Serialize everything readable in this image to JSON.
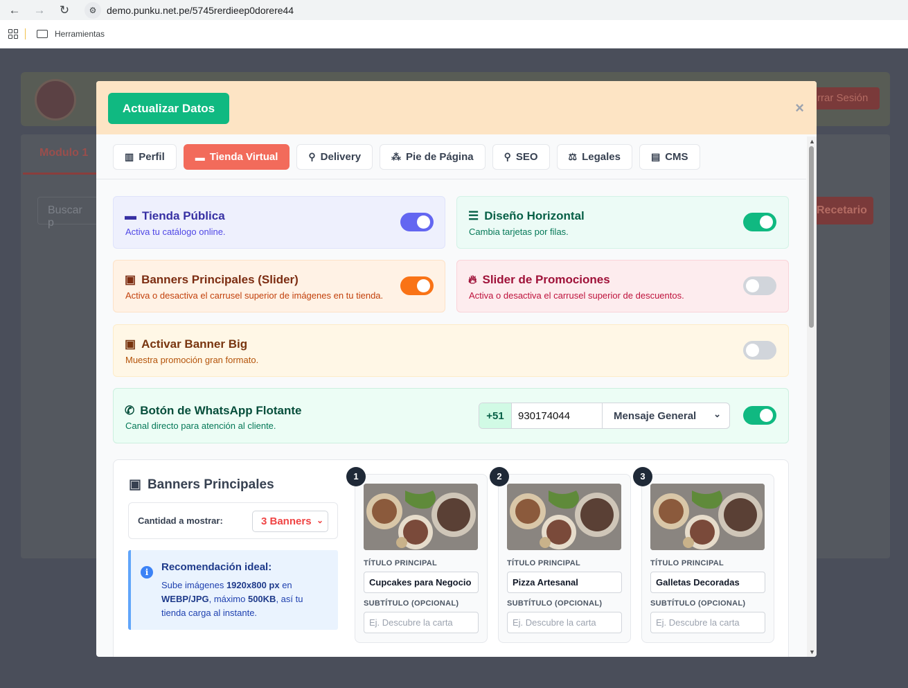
{
  "browser": {
    "url": "demo.punku.net.pe/5745rerdieep0dorere44",
    "bookmark_folder": "Herramientas"
  },
  "background": {
    "logout_label": "rrar Sesión",
    "tab_label": "Modulo 1",
    "search_placeholder": "Buscar p",
    "recetario_label": "Recetario"
  },
  "modal": {
    "update_button": "Actualizar Datos",
    "close_symbol": "×",
    "tabs": [
      {
        "label": "Perfil",
        "icon": "building-icon"
      },
      {
        "label": "Tienda Virtual",
        "icon": "store-icon"
      },
      {
        "label": "Delivery",
        "icon": "motorcycle-icon"
      },
      {
        "label": "Pie de Página",
        "icon": "shoe-prints-icon"
      },
      {
        "label": "SEO",
        "icon": "search-icon"
      },
      {
        "label": "Legales",
        "icon": "scale-icon"
      },
      {
        "label": "CMS",
        "icon": "file-code-icon"
      }
    ],
    "active_tab": "Tienda Virtual",
    "features": {
      "tienda_publica": {
        "title": "Tienda Pública",
        "subtitle": "Activa tu catálogo online.",
        "enabled": true,
        "color": "#6366f1"
      },
      "diseno_horizontal": {
        "title": "Diseño Horizontal",
        "subtitle": "Cambia tarjetas por filas.",
        "enabled": true,
        "color": "#10b981"
      },
      "banners_principales": {
        "title": "Banners Principales (Slider)",
        "subtitle": "Activa o desactiva el carrusel superior de imágenes en tu tienda.",
        "enabled": true,
        "color": "#f97316"
      },
      "slider_promociones": {
        "title": "Slider de Promociones",
        "subtitle": "Activa o desactiva el carrusel superior de descuentos.",
        "enabled": false,
        "color": "#d1d5db"
      },
      "banner_big": {
        "title": "Activar Banner Big",
        "subtitle": "Muestra promoción gran formato.",
        "enabled": false,
        "color": "#d1d5db"
      },
      "whatsapp": {
        "title": "Botón de WhatsApp Flotante",
        "subtitle": "Canal directo para atención al cliente.",
        "prefix": "+51",
        "phone": "930174044",
        "message_type": "Mensaje General",
        "enabled": true,
        "color": "#10b981"
      }
    },
    "banners_section": {
      "title": "Banners Principales",
      "quantity_label": "Cantidad a mostrar:",
      "quantity_value": "3 Banners",
      "recommendation": {
        "title": "Recomendación ideal:",
        "text_1": "Sube imágenes ",
        "size": "1920x800 px",
        "text_2": " en ",
        "formats": "WEBP/JPG",
        "text_3": ", máximo ",
        "max": "500KB",
        "text_4": ", así tu tienda carga al instante."
      },
      "main_title_label": "TÍTULO PRINCIPAL",
      "subtitle_label": "SUBTÍTULO (OPCIONAL)",
      "subtitle_placeholder": "Ej. Descubre la carta",
      "items": [
        {
          "number": "1",
          "title": "Cupcakes para Negocio"
        },
        {
          "number": "2",
          "title": "Pizza Artesanal"
        },
        {
          "number": "3",
          "title": "Galletas Decoradas"
        }
      ]
    }
  }
}
